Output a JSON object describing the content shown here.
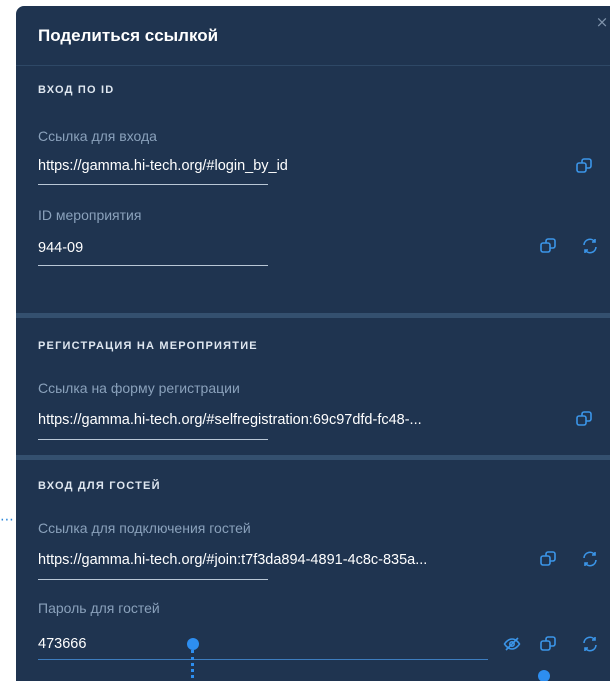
{
  "background": {
    "dots": "⋯"
  },
  "dialog": {
    "title": "Поделиться ссылкой",
    "close_icon": "×",
    "sections": {
      "login_by_id": {
        "title": "ВХОД ПО ID",
        "link_label": "Ссылка для входа",
        "link_value": "https://gamma.hi-tech.org/#login_by_id",
        "event_id_label": "ID мероприятия",
        "event_id_value": "944-09"
      },
      "registration": {
        "title": "РЕГИСТРАЦИЯ НА МЕРОПРИЯТИЕ",
        "form_link_label": "Ссылка на форму регистрации",
        "form_link_value": "https://gamma.hi-tech.org/#selfregistration:69c97dfd-fc48-..."
      },
      "guest_login": {
        "title": "ВХОД ДЛЯ ГОСТЕЙ",
        "guest_link_label": "Ссылка для подключения гостей",
        "guest_link_value": "https://gamma.hi-tech.org/#join:t7f3da894-4891-4c8c-835a...",
        "password_label": "Пароль для гостей",
        "password_value": "473666"
      }
    }
  },
  "icons": {
    "copy": "copy-icon",
    "refresh": "refresh-icon",
    "hide": "eye-off-icon"
  },
  "colors": {
    "dialog_bg": "#1f3450",
    "accent": "#3b95e8",
    "divider": "#34506f"
  }
}
